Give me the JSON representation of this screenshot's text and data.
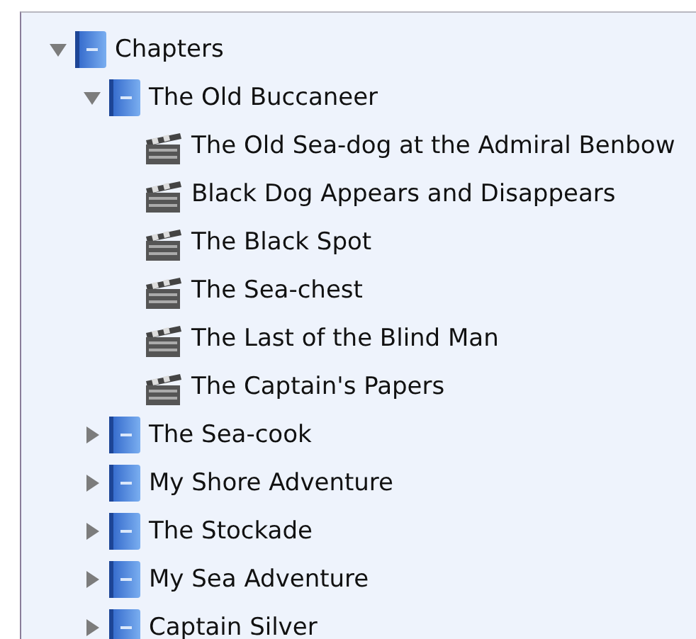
{
  "tree": [
    {
      "label": "Chapters",
      "kind": "folder",
      "expanded": true,
      "children": [
        {
          "label": "The Old Buccaneer",
          "kind": "folder",
          "expanded": true,
          "children": [
            {
              "label": "The Old Sea-dog at the Admiral Benbow",
              "kind": "scene"
            },
            {
              "label": "Black Dog Appears and Disappears",
              "kind": "scene"
            },
            {
              "label": "The Black Spot",
              "kind": "scene"
            },
            {
              "label": "The Sea-chest",
              "kind": "scene"
            },
            {
              "label": "The Last of the Blind Man",
              "kind": "scene"
            },
            {
              "label": "The Captain's Papers",
              "kind": "scene"
            }
          ]
        },
        {
          "label": "The Sea-cook",
          "kind": "folder",
          "expanded": false
        },
        {
          "label": "My Shore Adventure",
          "kind": "folder",
          "expanded": false
        },
        {
          "label": "The Stockade",
          "kind": "folder",
          "expanded": false
        },
        {
          "label": "My Sea Adventure",
          "kind": "folder",
          "expanded": false
        },
        {
          "label": "Captain Silver",
          "kind": "folder",
          "expanded": false
        }
      ]
    }
  ]
}
